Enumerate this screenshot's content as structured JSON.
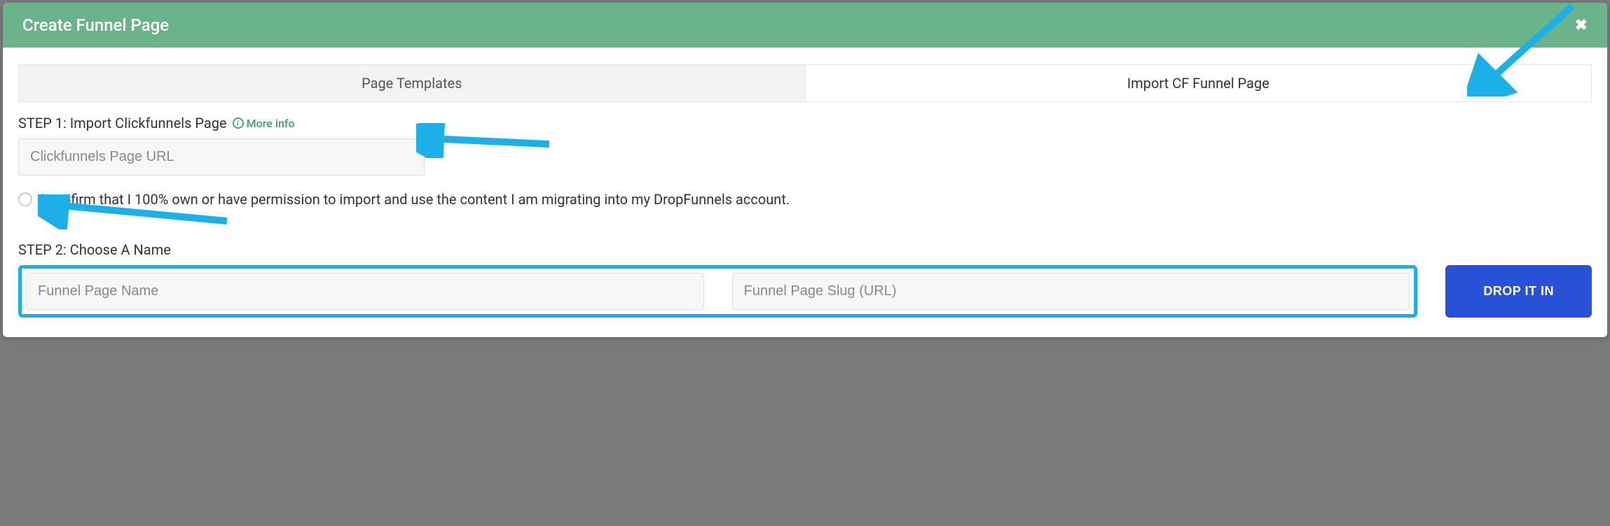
{
  "header": {
    "title": "Create Funnel Page",
    "close_label": "✖"
  },
  "tabs": {
    "templates": "Page Templates",
    "import": "Import CF Funnel Page"
  },
  "step1": {
    "label": "STEP 1: Import Clickfunnels Page",
    "more_info": "More info",
    "url_placeholder": "Clickfunnels Page URL"
  },
  "confirm": {
    "text": "I confirm that I 100% own or have permission to import and use the content I am migrating into my DropFunnels account."
  },
  "step2": {
    "label": "STEP 2: Choose A Name",
    "name_placeholder": "Funnel Page Name",
    "slug_placeholder": "Funnel Page Slug (URL)"
  },
  "submit": {
    "label": "DROP IT IN"
  }
}
